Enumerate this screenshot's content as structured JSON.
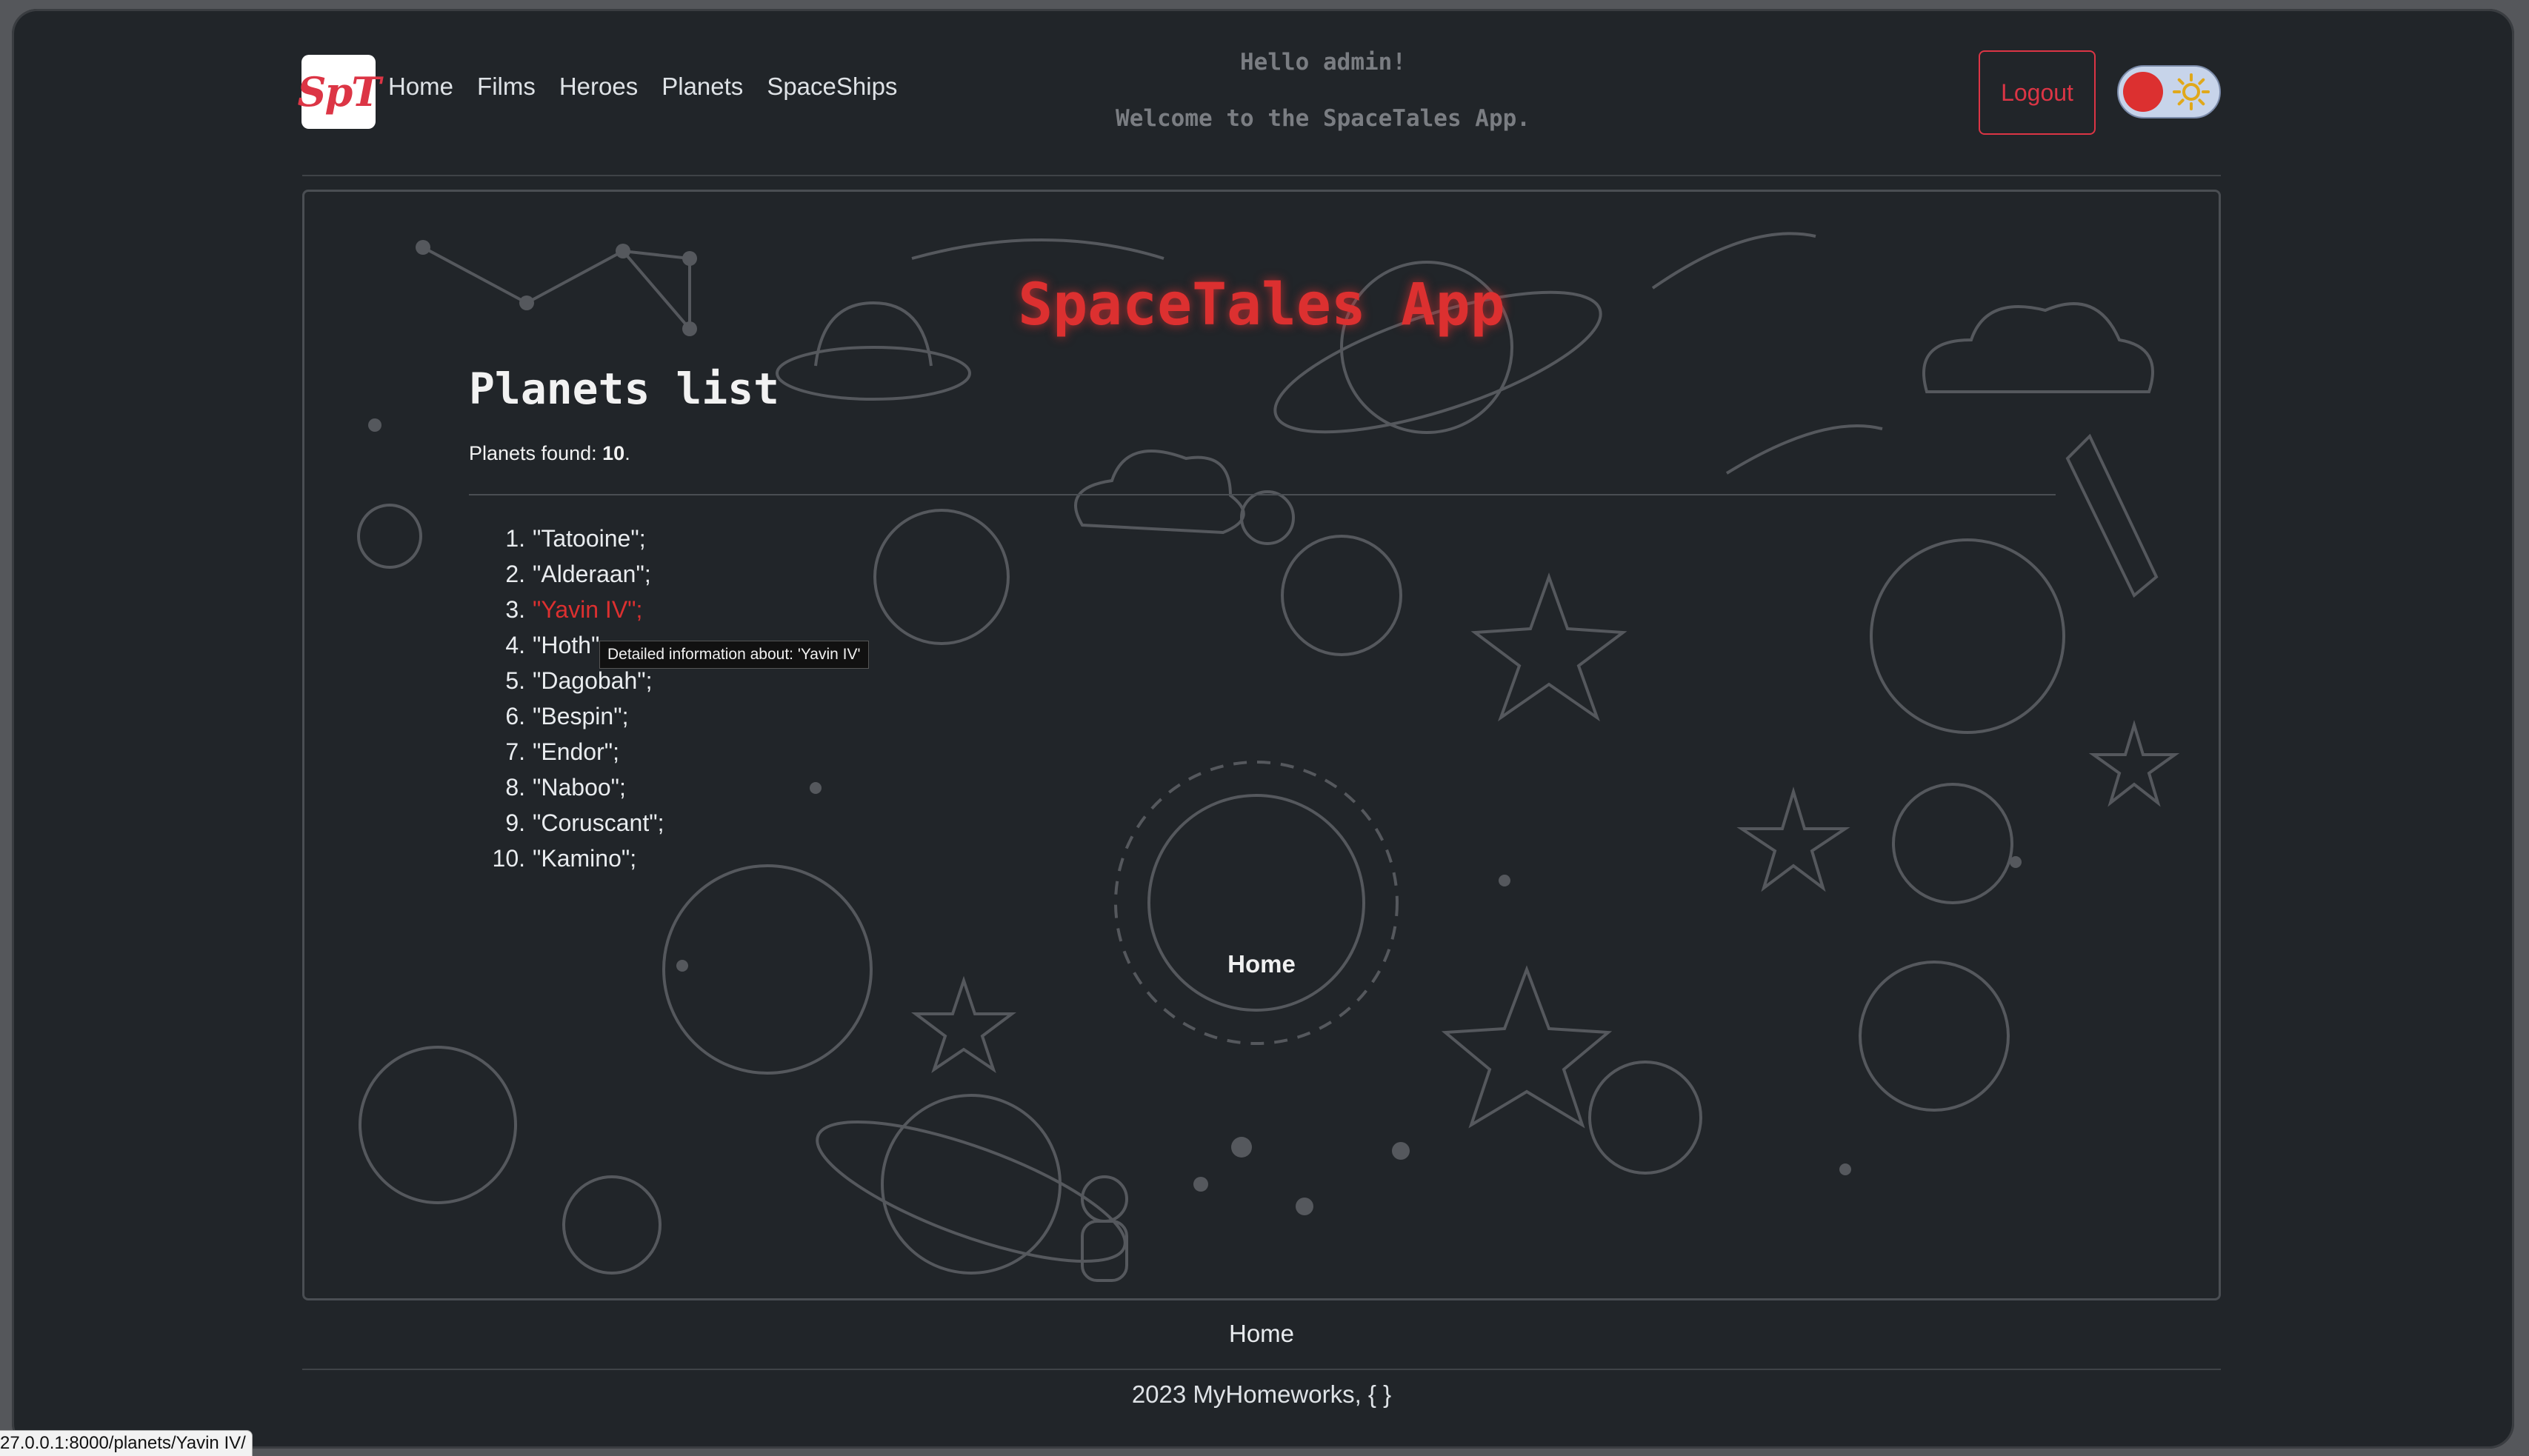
{
  "header": {
    "logo_text": "SpT",
    "nav": [
      "Home",
      "Films",
      "Heroes",
      "Planets",
      "SpaceShips"
    ],
    "greeting_line1": "Hello admin!",
    "greeting_line2": "Welcome to the SpaceTales App.",
    "logout_label": "Logout",
    "theme_toggle_icon": "sun-icon",
    "accent_color": "#dc3545"
  },
  "main": {
    "app_title": "SpaceTales App",
    "page_title": "Planets list",
    "found_label": "Planets found: ",
    "found_count": "10",
    "found_suffix": ".",
    "planets": [
      {
        "num": "1.",
        "name": "\"Tatooine\";"
      },
      {
        "num": "2.",
        "name": "\"Alderaan\";"
      },
      {
        "num": "3.",
        "name": "\"Yavin IV\";"
      },
      {
        "num": "4.",
        "name": "\"Hoth\""
      },
      {
        "num": "5.",
        "name": "\"Dagobah\";"
      },
      {
        "num": "6.",
        "name": "\"Bespin\";"
      },
      {
        "num": "7.",
        "name": "\"Endor\";"
      },
      {
        "num": "8.",
        "name": "\"Naboo\";"
      },
      {
        "num": "9.",
        "name": "\"Coruscant\";"
      },
      {
        "num": "10.",
        "name": "\"Kamino\";"
      }
    ],
    "tooltip": "Detailed information about: 'Yavin IV'",
    "inner_home": "Home"
  },
  "footer": {
    "home_link": "Home",
    "copyright": "2023 MyHomeworks, { }"
  },
  "status_bar": {
    "url": "27.0.0.1:8000/planets/Yavin IV/"
  }
}
